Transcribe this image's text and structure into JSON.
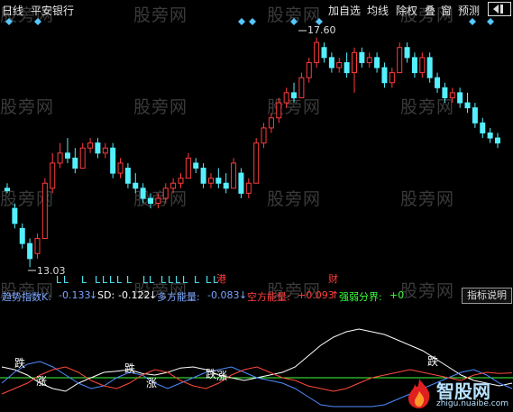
{
  "toolbar": {
    "period": "日线",
    "stock": "平安银行",
    "buttons": [
      "加自选",
      "均线",
      "除权",
      "叠",
      "窗",
      "预测"
    ],
    "nav_icon": "back-arrow-icon"
  },
  "watermark": "股旁网",
  "price_panel": {
    "high_label": "17.60",
    "low_label": "13.03",
    "marker_gang": "港",
    "marker_cai": "财",
    "signal_char": "L",
    "colors": {
      "up": "#ff3c3c",
      "down": "#54f0ff",
      "signal": "#54f0ff",
      "marker": "#ff3c3c"
    }
  },
  "indicator_bar": {
    "name": "强弱分界",
    "items": [
      {
        "label": "趋势指数K:",
        "value": "-0.133",
        "arrow": "↓",
        "color": "#7aa6ff"
      },
      {
        "label": "SD:",
        "value": "-0.122",
        "arrow": "↓",
        "color": "#ffffff"
      },
      {
        "label": "多方能量:",
        "value": "-0.083",
        "arrow": "↓",
        "color": "#7aa6ff"
      },
      {
        "label": "空方能量:",
        "value": "+0.093",
        "arrow": "↑",
        "color": "#ff4040"
      },
      {
        "label": "强弱分界:",
        "value": "+0",
        "arrow": "",
        "color": "#3cff3c"
      }
    ],
    "explain_button": "指标说明"
  },
  "oscillator": {
    "labels_up": "跌",
    "labels_down": "涨",
    "colors": {
      "white_line": "#ffffff",
      "blue_line": "#4f8bff",
      "red_line": "#ff4a3a",
      "zero_line": "#3cff3c"
    }
  },
  "logo": {
    "title": "智股网",
    "url": "zhigu.nuaibe.com"
  },
  "chart_data": [
    {
      "type": "candlestick",
      "title": "",
      "ylabel": "",
      "annotations": [
        {
          "text": "17.60",
          "kind": "high"
        },
        {
          "text": "13.03",
          "kind": "low"
        }
      ],
      "candles": [
        [
          14.6,
          14.7,
          14.5,
          14.55
        ],
        [
          14.2,
          14.3,
          13.8,
          13.9
        ],
        [
          13.8,
          13.9,
          13.4,
          13.5
        ],
        [
          13.5,
          13.6,
          13.03,
          13.2
        ],
        [
          13.3,
          13.7,
          13.2,
          13.6
        ],
        [
          13.6,
          14.8,
          13.6,
          14.7
        ],
        [
          14.6,
          15.3,
          14.5,
          15.1
        ],
        [
          15.1,
          15.5,
          15.0,
          15.3
        ],
        [
          15.3,
          15.6,
          15.1,
          15.2
        ],
        [
          15.2,
          15.4,
          14.9,
          15.0
        ],
        [
          15.0,
          15.5,
          15.0,
          15.4
        ],
        [
          15.4,
          15.6,
          15.3,
          15.5
        ],
        [
          15.5,
          15.6,
          15.2,
          15.3
        ],
        [
          15.3,
          15.5,
          15.2,
          15.4
        ],
        [
          15.4,
          15.5,
          14.8,
          14.9
        ],
        [
          14.9,
          15.2,
          14.8,
          15.1
        ],
        [
          15.0,
          15.1,
          14.6,
          14.7
        ],
        [
          14.7,
          14.9,
          14.5,
          14.6
        ],
        [
          14.6,
          14.7,
          14.3,
          14.4
        ],
        [
          14.4,
          14.5,
          14.2,
          14.3
        ],
        [
          14.3,
          14.5,
          14.2,
          14.4
        ],
        [
          14.4,
          14.7,
          14.3,
          14.6
        ],
        [
          14.6,
          14.8,
          14.5,
          14.7
        ],
        [
          14.7,
          14.9,
          14.6,
          14.8
        ],
        [
          14.8,
          15.3,
          14.8,
          15.2
        ],
        [
          15.1,
          15.2,
          14.9,
          15.0
        ],
        [
          15.0,
          15.1,
          14.6,
          14.7
        ],
        [
          14.7,
          14.9,
          14.6,
          14.8
        ],
        [
          14.8,
          15.0,
          14.6,
          14.7
        ],
        [
          14.7,
          14.9,
          14.5,
          14.6
        ],
        [
          14.6,
          15.2,
          14.6,
          15.1
        ],
        [
          14.9,
          15.0,
          14.4,
          14.5
        ],
        [
          14.5,
          14.8,
          14.4,
          14.7
        ],
        [
          14.7,
          15.6,
          14.7,
          15.5
        ],
        [
          15.5,
          15.9,
          15.4,
          15.8
        ],
        [
          15.8,
          16.1,
          15.7,
          16.0
        ],
        [
          16.0,
          16.4,
          15.9,
          16.3
        ],
        [
          16.3,
          16.6,
          16.2,
          16.5
        ],
        [
          16.5,
          16.7,
          16.3,
          16.4
        ],
        [
          16.4,
          16.9,
          16.4,
          16.8
        ],
        [
          16.8,
          17.2,
          16.7,
          17.1
        ],
        [
          17.1,
          17.6,
          17.0,
          17.5
        ],
        [
          17.4,
          17.5,
          17.1,
          17.2
        ],
        [
          17.2,
          17.3,
          16.9,
          17.0
        ],
        [
          17.0,
          17.2,
          16.9,
          17.1
        ],
        [
          17.1,
          17.3,
          16.8,
          16.9
        ],
        [
          16.9,
          17.4,
          16.5,
          17.3
        ],
        [
          17.3,
          17.4,
          17.0,
          17.1
        ],
        [
          17.1,
          17.3,
          17.0,
          17.2
        ],
        [
          17.2,
          17.3,
          16.9,
          17.0
        ],
        [
          17.0,
          17.1,
          16.6,
          16.7
        ],
        [
          16.7,
          17.0,
          16.6,
          16.9
        ],
        [
          16.9,
          17.5,
          16.9,
          17.4
        ],
        [
          17.4,
          17.5,
          17.1,
          17.2
        ],
        [
          17.2,
          17.3,
          16.8,
          16.9
        ],
        [
          16.9,
          17.3,
          16.8,
          17.2
        ],
        [
          17.2,
          17.3,
          16.7,
          16.8
        ],
        [
          16.8,
          16.9,
          16.5,
          16.6
        ],
        [
          16.6,
          16.7,
          16.3,
          16.4
        ],
        [
          16.4,
          16.6,
          16.3,
          16.5
        ],
        [
          16.5,
          16.6,
          16.2,
          16.3
        ],
        [
          16.3,
          16.5,
          16.1,
          16.2
        ],
        [
          16.2,
          16.3,
          15.8,
          15.9
        ],
        [
          15.9,
          16.0,
          15.6,
          15.7
        ],
        [
          15.7,
          15.8,
          15.5,
          15.6
        ],
        [
          15.6,
          15.7,
          15.4,
          15.5
        ]
      ]
    },
    {
      "type": "line",
      "title": "",
      "series": [
        {
          "values": [
            0.2,
            0.15,
            0.05,
            -0.1,
            -0.2,
            -0.25,
            -0.1,
            0.0,
            0.1,
            0.12,
            0.15,
            0.08,
            0.05,
            0.1,
            0.18,
            0.2,
            0.15,
            0.05,
            0.0,
            -0.05,
            0.0,
            0.05,
            0.1,
            0.2,
            0.4,
            0.6,
            0.75,
            0.85,
            0.9,
            0.85,
            0.8,
            0.7,
            0.6,
            0.5,
            0.35,
            0.2,
            0.05,
            -0.05,
            -0.1,
            -0.15,
            -0.1
          ]
        },
        {
          "values": [
            -0.1,
            0.1,
            0.25,
            0.3,
            0.2,
            0.05,
            -0.1,
            -0.2,
            -0.15,
            0.0,
            0.1,
            0.05,
            -0.1,
            -0.2,
            -0.1,
            0.0,
            0.1,
            0.15,
            0.2,
            0.1,
            0.0,
            -0.05,
            -0.1,
            -0.2,
            -0.35,
            -0.5,
            -0.6,
            -0.7,
            -0.72,
            -0.65,
            -0.5,
            -0.4,
            -0.3,
            -0.2,
            -0.1,
            0.0,
            0.1,
            0.15,
            0.05,
            -0.1,
            -0.2
          ]
        },
        {
          "values": [
            -0.3,
            -0.2,
            -0.1,
            0.05,
            0.15,
            0.2,
            0.1,
            -0.05,
            -0.15,
            -0.2,
            -0.1,
            0.05,
            0.15,
            0.1,
            -0.05,
            -0.15,
            -0.2,
            -0.1,
            0.05,
            0.15,
            0.2,
            0.1,
            0.0,
            -0.05,
            -0.15,
            -0.2,
            -0.25,
            -0.2,
            -0.1,
            0.0,
            0.05,
            0.1,
            0.15,
            0.1,
            0.05,
            0.0,
            -0.05,
            0.05,
            0.1,
            0.08,
            0.09
          ]
        }
      ],
      "zero_line": 0
    }
  ]
}
